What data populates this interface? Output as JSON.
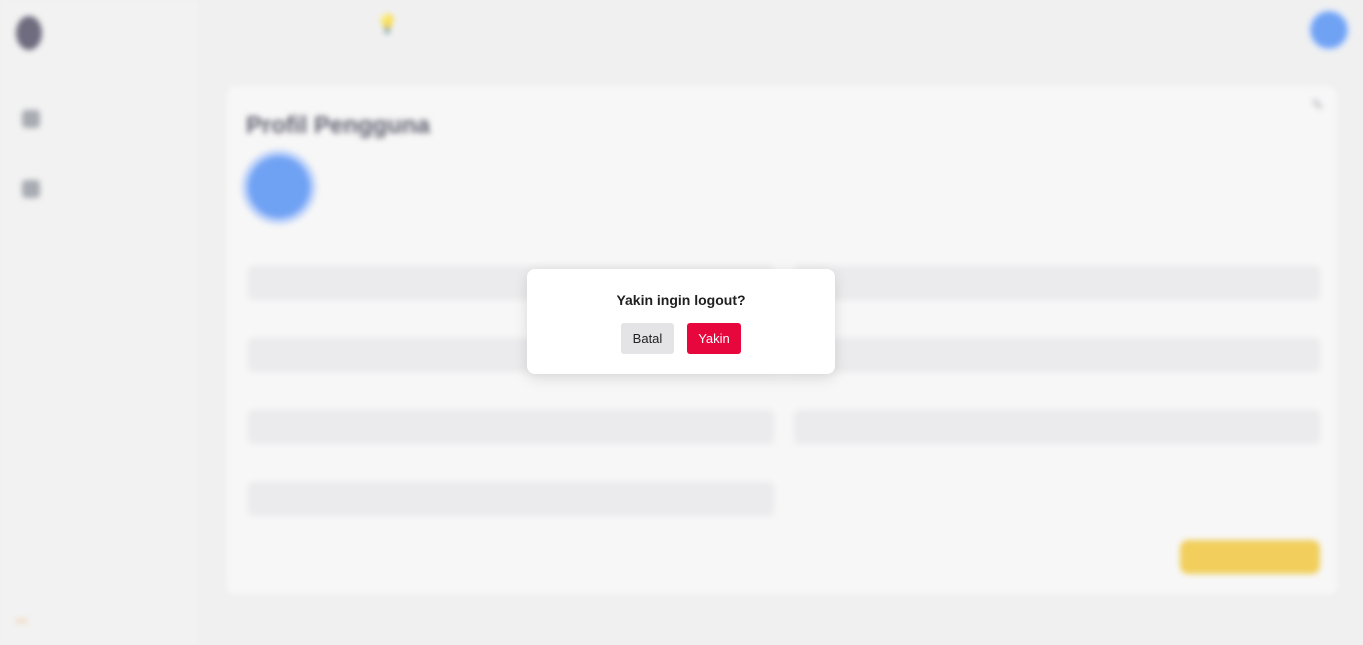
{
  "modal": {
    "title": "Yakin ingin logout?",
    "cancel_label": "Batal",
    "confirm_label": "Yakin"
  },
  "colors": {
    "confirm": "#e8073d",
    "cancel": "#e4e4e6",
    "accent": "#3b82f6",
    "save": "#f3c21f"
  },
  "background": {
    "card_title": "Profil Pengguna"
  }
}
